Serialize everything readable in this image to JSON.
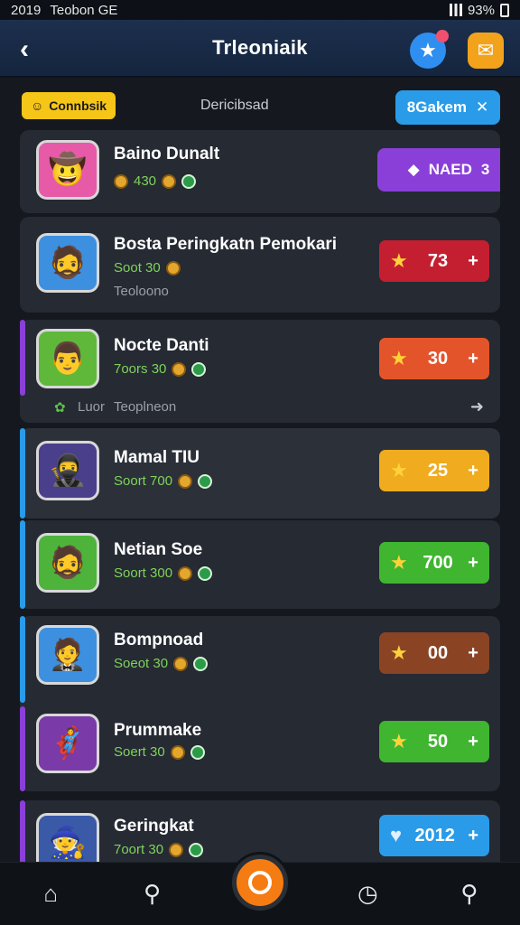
{
  "status": {
    "time": "2019",
    "carrier": "Teobon GE",
    "battery": "93%"
  },
  "header": {
    "title": "Trleoniaik",
    "back_icon": "chevron-left-icon",
    "star_icon": "star-icon",
    "mail_icon": "mail-icon"
  },
  "topbar": {
    "left_label": "Connbsik",
    "center_label": "Dericibsad",
    "right_label": "8Gakem",
    "right_icon": "close-icon"
  },
  "rows": [
    {
      "name": "Baino Dunalt",
      "stats": "430",
      "sub": "",
      "badge": "NAED",
      "badge_num": "3",
      "avatar_icon": "cowboy-avatar",
      "stripe": ""
    },
    {
      "name": "Bosta Peringkatn Pemokari",
      "stats": "Soot 30",
      "sub": "Teoloono",
      "score": "73",
      "score_color": "#c41f30",
      "avatar_icon": "warrior-avatar",
      "stripe": ""
    },
    {
      "name": "Nocte Danti",
      "stats": "7oors 30",
      "sub": "",
      "score": "30",
      "score_color": "#e4542a",
      "avatar_icon": "person-avatar",
      "stripe": "#8a3fd8"
    },
    {
      "name": "Mamal TIU",
      "stats": "Soort 700",
      "sub": "",
      "score": "25",
      "score_color": "#f0ab1e",
      "avatar_icon": "ninja-avatar",
      "stripe": "#2a9be8"
    },
    {
      "name": "Netian Soe",
      "stats": "Soort 300",
      "sub": "",
      "score": "700",
      "score_color": "#3fb530",
      "avatar_icon": "pirate-avatar",
      "stripe": "#2a9be8"
    },
    {
      "name": "Bompnoad",
      "stats": "Soeot 30",
      "sub": "",
      "score": "00",
      "score_color": "#8a4424",
      "avatar_icon": "adventurer-avatar",
      "stripe": "#2a9be8"
    },
    {
      "name": "Prummake",
      "stats": "Soert 30",
      "sub": "",
      "score": "50",
      "score_color": "#3fb530",
      "avatar_icon": "hero-avatar",
      "stripe": "#8a3fd8"
    },
    {
      "name": "Geringkat",
      "stats": "7oort 30",
      "sub": "",
      "score": "2012",
      "score_color": "#2a9be8",
      "avatar_icon": "wizard-avatar",
      "stripe": "#8a3fd8"
    }
  ],
  "footnote": {
    "left": "Luor",
    "text": "Teoplneon"
  },
  "nav": {
    "home": "home-icon",
    "search": "search-icon",
    "center": "record-icon",
    "clock": "clock-icon",
    "pin": "location-pin-icon"
  }
}
